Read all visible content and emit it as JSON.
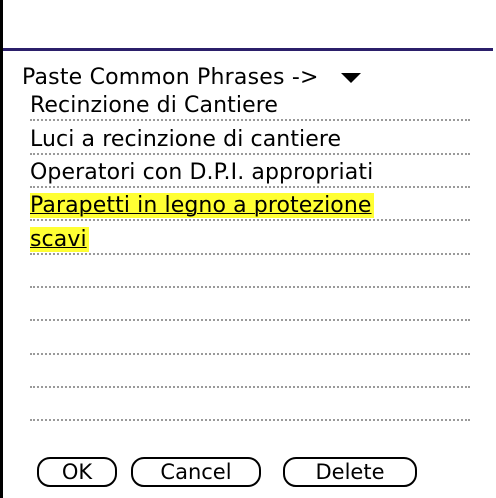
{
  "phrases": {
    "trigger_label": "Paste Common Phrases ->",
    "trigger_icon": "chevron-down-icon"
  },
  "note": {
    "lines": [
      "Recinzione di Cantiere",
      "Luci a recinzione di cantiere",
      "Operatori con D.P.I. appropriati",
      "Parapetti in legno a protezione",
      "scavi"
    ],
    "highlight_color": "#ffff33"
  },
  "buttons": {
    "ok": "OK",
    "cancel": "Cancel",
    "delete": "Delete"
  }
}
